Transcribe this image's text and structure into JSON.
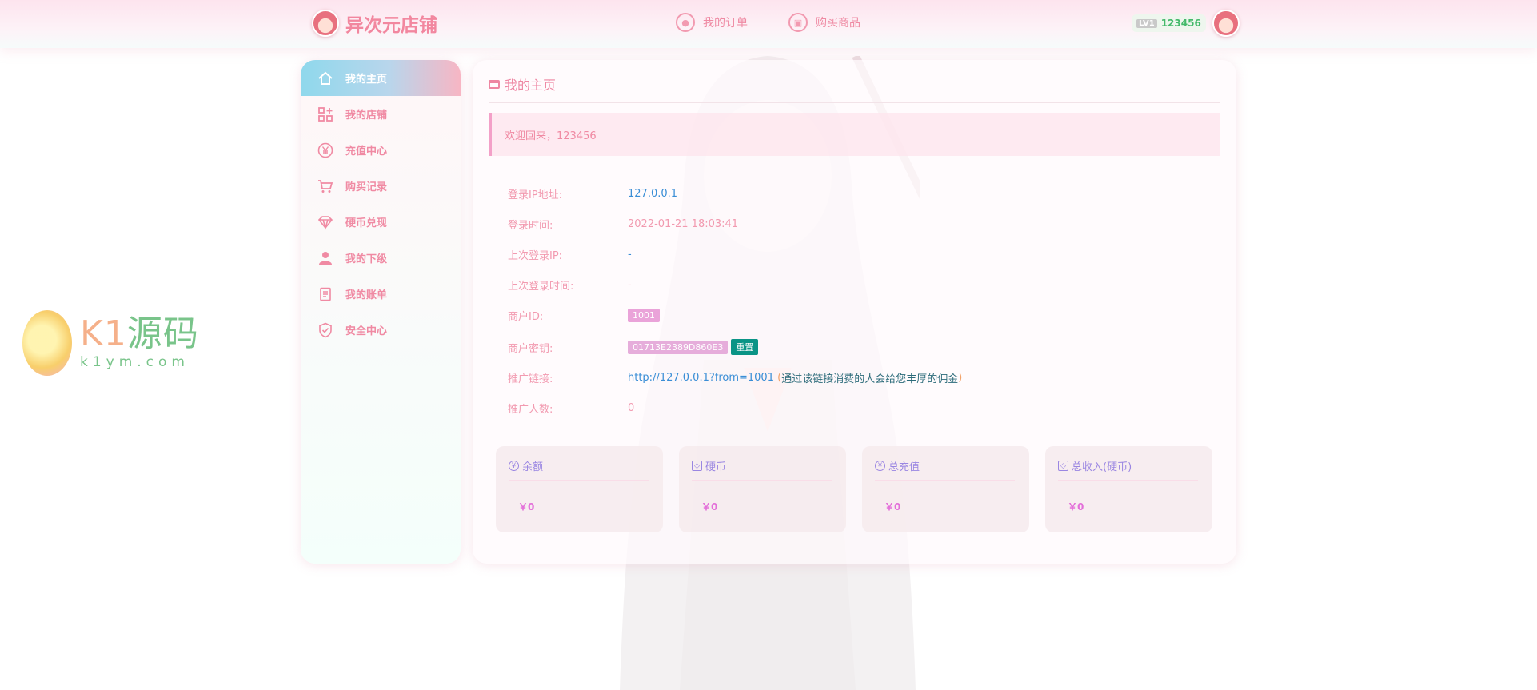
{
  "colors": {
    "accent": "#f08aa3",
    "link": "#3a8ed6",
    "reset": "#0a9486",
    "stat_value": "#e36fd9"
  },
  "header": {
    "logo_text": "异次元店铺",
    "nav": [
      {
        "label": "我的订单",
        "icon": "order-icon"
      },
      {
        "label": "购买商品",
        "icon": "shop-bag-icon"
      }
    ],
    "level_badge": "LV1",
    "username": "123456"
  },
  "sidebar": {
    "items": [
      {
        "label": "我的主页",
        "icon": "home-icon",
        "active": true
      },
      {
        "label": "我的店铺",
        "icon": "apps-icon"
      },
      {
        "label": "充值中心",
        "icon": "yen-icon"
      },
      {
        "label": "购买记录",
        "icon": "cart-icon"
      },
      {
        "label": "硬币兑现",
        "icon": "diamond-icon"
      },
      {
        "label": "我的下级",
        "icon": "user-icon"
      },
      {
        "label": "我的账单",
        "icon": "bill-icon"
      },
      {
        "label": "安全中心",
        "icon": "shield-icon"
      }
    ]
  },
  "main": {
    "title": "我的主页",
    "welcome": "欢迎回来，123456",
    "info": {
      "login_ip_label": "登录IP地址:",
      "login_ip": "127.0.0.1",
      "login_time_label": "登录时间:",
      "login_time": "2022-01-21 18:03:41",
      "last_ip_label": "上次登录IP:",
      "last_ip": "-",
      "last_time_label": "上次登录时间:",
      "last_time": "-",
      "merchant_id_label": "商户ID:",
      "merchant_id": "1001",
      "merchant_key_label": "商户密钥:",
      "merchant_key": "01713E2389D860E3",
      "reset_label": "重置",
      "promo_link_label": "推广链接:",
      "promo_link": "http://127.0.0.1?from=1001",
      "promo_hint": "通过该链接消费的人会给您丰厚的佣金",
      "promo_count_label": "推广人数:",
      "promo_count": "0"
    },
    "stats": [
      {
        "label": "余额",
        "icon": "yen-icon",
        "value": "￥0"
      },
      {
        "label": "硬币",
        "icon": "diamond-icon",
        "value": "￥0"
      },
      {
        "label": "总充值",
        "icon": "yen-icon",
        "value": "￥0"
      },
      {
        "label": "总收入(硬币)",
        "icon": "diamond-icon",
        "value": "￥0"
      }
    ]
  },
  "watermark": {
    "main_k": "K1",
    "main_cn": "源码",
    "sub": "k1ym.com"
  }
}
